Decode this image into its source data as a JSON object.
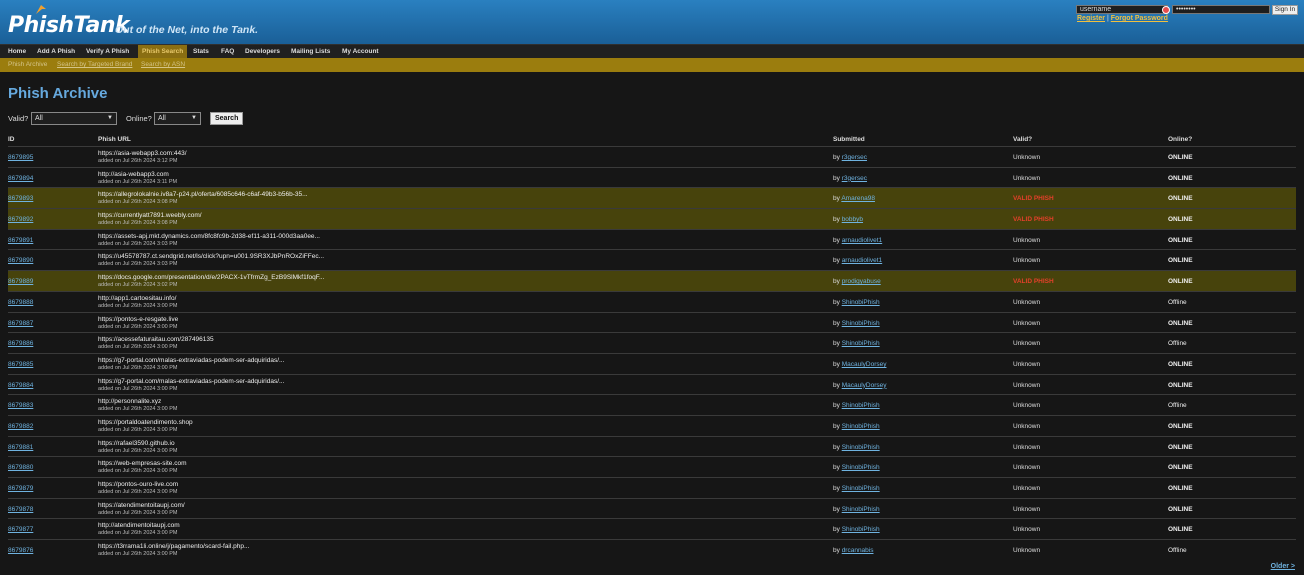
{
  "header": {
    "brand": "PhishTank",
    "tagline": "Out of the Net, into the Tank.",
    "login": {
      "username_value": "username",
      "password_value": "••••••••",
      "signin_label": "Sign In",
      "register_label": "Register",
      "separator": "|",
      "forgot_label": "Forgot Password"
    }
  },
  "nav": {
    "items": [
      "Home",
      "Add A Phish",
      "Verify A Phish",
      "Phish Search",
      "Stats",
      "FAQ",
      "Developers",
      "Mailing Lists",
      "My Account"
    ],
    "active": "Phish Search"
  },
  "subnav": {
    "items": [
      "Phish Archive",
      "Search by Targeted Brand",
      "Search by ASN"
    ]
  },
  "page_title": "Phish Archive",
  "filters": {
    "valid_label": "Valid?",
    "valid_value": "All",
    "online_label": "Online?",
    "online_value": "All",
    "search_label": "Search"
  },
  "table": {
    "headers": [
      "ID",
      "Phish URL",
      "Submitted",
      "Valid?",
      "Online?"
    ],
    "rows": [
      {
        "id": "8679895",
        "url": "https://asia-webapp3.com:443/",
        "added": "added on Jul 26th 2024 3:12 PM",
        "by_prefix": "by",
        "by": "r3gersec",
        "valid": "Unknown",
        "online": "ONLINE"
      },
      {
        "id": "8679894",
        "url": "http://asia-webapp3.com",
        "added": "added on Jul 26th 2024 3:11 PM",
        "by_prefix": "by",
        "by": "r3gersec",
        "valid": "Unknown",
        "online": "ONLINE"
      },
      {
        "id": "8679893",
        "url": "https://allegrolokalnie.iv8a7-p24.pl/oferta/6085c646-c6af-49b3-b56b-35...",
        "added": "added on Jul 26th 2024 3:08 PM",
        "by_prefix": "by",
        "by": "Amarena98",
        "valid": "VALID PHISH",
        "online": "ONLINE"
      },
      {
        "id": "8679892",
        "url": "https://currentlyatt7891.weebly.com/",
        "added": "added on Jul 26th 2024 3:08 PM",
        "by_prefix": "by",
        "by": "bobbyb",
        "valid": "VALID PHISH",
        "online": "ONLINE"
      },
      {
        "id": "8679891",
        "url": "https://assets-apj.mkt.dynamics.com/8fc8fc9b-2d38-ef11-a311-000d3aa0ee...",
        "added": "added on Jul 26th 2024 3:03 PM",
        "by_prefix": "by",
        "by": "arnaudiolivet1",
        "valid": "Unknown",
        "online": "ONLINE"
      },
      {
        "id": "8679890",
        "url": "https://u45578787.ct.sendgrid.net/ls/click?upn=u001.9SR3XJbPnROxZiFFec...",
        "added": "added on Jul 26th 2024 3:03 PM",
        "by_prefix": "by",
        "by": "arnaudiolivet1",
        "valid": "Unknown",
        "online": "ONLINE"
      },
      {
        "id": "8679889",
        "url": "https://docs.google.com/presentation/d/e/2PACX-1vTfrmZg_EzB9SlMkf1foqF...",
        "added": "added on Jul 26th 2024 3:02 PM",
        "by_prefix": "by",
        "by": "prodigyabuse",
        "valid": "VALID PHISH",
        "online": "ONLINE"
      },
      {
        "id": "8679888",
        "url": "http://app1.cartoesitau.info/",
        "added": "added on Jul 26th 2024 3:00 PM",
        "by_prefix": "by",
        "by": "ShinobiPhish",
        "valid": "Unknown",
        "online": "Offline"
      },
      {
        "id": "8679887",
        "url": "https://pontos-e-resgate.live",
        "added": "added on Jul 26th 2024 3:00 PM",
        "by_prefix": "by",
        "by": "ShinobiPhish",
        "valid": "Unknown",
        "online": "ONLINE"
      },
      {
        "id": "8679886",
        "url": "https://acessefaturaitau.com/287496135",
        "added": "added on Jul 26th 2024 3:00 PM",
        "by_prefix": "by",
        "by": "ShinobiPhish",
        "valid": "Unknown",
        "online": "Offline"
      },
      {
        "id": "8679885",
        "url": "https://g7-portal.com/malas-extraviadas-podem-ser-adquiridas/...",
        "added": "added on Jul 26th 2024 3:00 PM",
        "by_prefix": "by",
        "by": "MacaulyDorsey",
        "valid": "Unknown",
        "online": "ONLINE"
      },
      {
        "id": "8679884",
        "url": "https://g7-portal.com/malas-extraviadas-podem-ser-adquiridas/...",
        "added": "added on Jul 26th 2024 3:00 PM",
        "by_prefix": "by",
        "by": "MacaulyDorsey",
        "valid": "Unknown",
        "online": "ONLINE"
      },
      {
        "id": "8679883",
        "url": "http://personnalite.xyz",
        "added": "added on Jul 26th 2024 3:00 PM",
        "by_prefix": "by",
        "by": "ShinobiPhish",
        "valid": "Unknown",
        "online": "Offline"
      },
      {
        "id": "8679882",
        "url": "https://portaldoatendimento.shop",
        "added": "added on Jul 26th 2024 3:00 PM",
        "by_prefix": "by",
        "by": "ShinobiPhish",
        "valid": "Unknown",
        "online": "ONLINE"
      },
      {
        "id": "8679881",
        "url": "https://rafael3590.github.io",
        "added": "added on Jul 26th 2024 3:00 PM",
        "by_prefix": "by",
        "by": "ShinobiPhish",
        "valid": "Unknown",
        "online": "ONLINE"
      },
      {
        "id": "8679880",
        "url": "https://web-empresas-site.com",
        "added": "added on Jul 26th 2024 3:00 PM",
        "by_prefix": "by",
        "by": "ShinobiPhish",
        "valid": "Unknown",
        "online": "ONLINE"
      },
      {
        "id": "8679879",
        "url": "https://pontos-ouro-live.com",
        "added": "added on Jul 26th 2024 3:00 PM",
        "by_prefix": "by",
        "by": "ShinobiPhish",
        "valid": "Unknown",
        "online": "ONLINE"
      },
      {
        "id": "8679878",
        "url": "https://atendimentoitaupj.com/",
        "added": "added on Jul 26th 2024 3:00 PM",
        "by_prefix": "by",
        "by": "ShinobiPhish",
        "valid": "Unknown",
        "online": "ONLINE"
      },
      {
        "id": "8679877",
        "url": "http://atendimentoitaupj.com",
        "added": "added on Jul 26th 2024 3:00 PM",
        "by_prefix": "by",
        "by": "ShinobiPhish",
        "valid": "Unknown",
        "online": "ONLINE"
      },
      {
        "id": "8679876",
        "url": "https://t3rrama1li.online/j/pagamento/scard-fail.php...",
        "added": "added on Jul 26th 2024 3:00 PM",
        "by_prefix": "by",
        "by": "drcannabis",
        "valid": "Unknown",
        "online": "Offline"
      }
    ]
  },
  "pagination": {
    "older_label": "Older >"
  },
  "colors": {
    "header_blue": "#1a5f97",
    "accent_gold": "#9b7d0e",
    "valid_row": "#47430c",
    "valid_text": "#e2402a",
    "link": "#6fb3e0"
  }
}
